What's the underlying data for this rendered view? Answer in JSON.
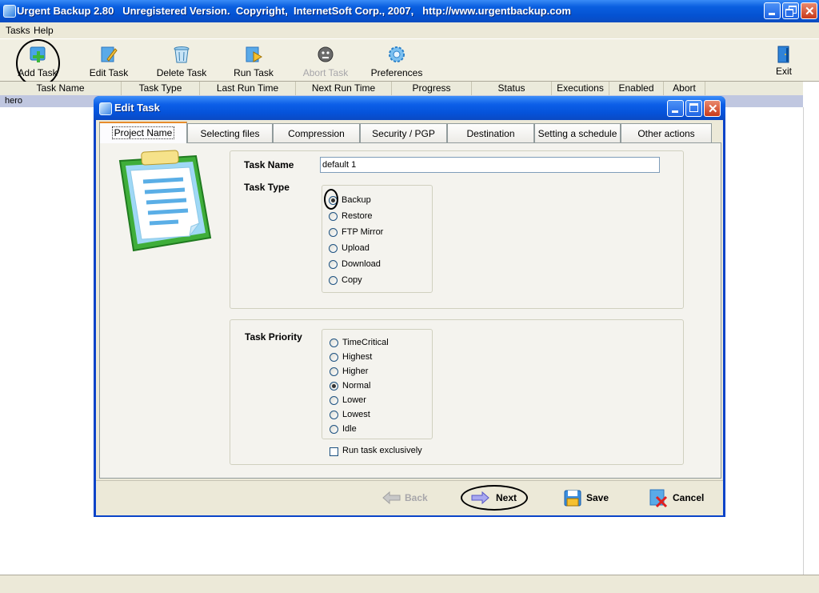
{
  "window": {
    "title": "Urgent Backup 2.80   Unregistered Version.  Copyright,  InternetSoft Corp., 2007,   http://www.urgentbackup.com"
  },
  "menu": {
    "items": [
      "Tasks",
      "Help"
    ]
  },
  "toolbar": {
    "add_task": "Add Task",
    "edit_task": "Edit Task",
    "delete_task": "Delete Task",
    "run_task": "Run Task",
    "abort_task": "Abort Task",
    "preferences": "Preferences",
    "exit": "Exit"
  },
  "task_list": {
    "columns": [
      "Task Name",
      "Task Type",
      "Last Run Time",
      "Next Run Time",
      "Progress",
      "Status",
      "Executions",
      "Enabled",
      "Abort"
    ],
    "rows": [
      {
        "task_name": "hero"
      }
    ]
  },
  "dialog": {
    "title": "Edit Task",
    "tabs": [
      "Project Name",
      "Selecting files",
      "Compression",
      "Security / PGP",
      "Destination",
      "Setting a schedule",
      "Other actions"
    ],
    "active_tab": "Project Name",
    "task_name_label": "Task Name",
    "task_name_value": "default 1",
    "task_type_label": "Task Type",
    "task_types": [
      "Backup",
      "Restore",
      "FTP Mirror",
      "Upload",
      "Download",
      "Copy"
    ],
    "selected_task_type": "Backup",
    "task_priority_label": "Task Priority",
    "priorities": [
      "TimeCritical",
      "Highest",
      "Higher",
      "Normal",
      "Lower",
      "Lowest",
      "Idle"
    ],
    "selected_priority": "Normal",
    "run_exclusively_label": "Run task exclusively",
    "run_exclusively_checked": false,
    "buttons": {
      "back": "Back",
      "next": "Next",
      "save": "Save",
      "cancel": "Cancel"
    }
  },
  "colors": {
    "titlebar_blue": "#0452d2",
    "dialog_frame": "#0a43c8",
    "active_tab_accent": "#e68b2c",
    "radio_selected": "#21a121"
  }
}
